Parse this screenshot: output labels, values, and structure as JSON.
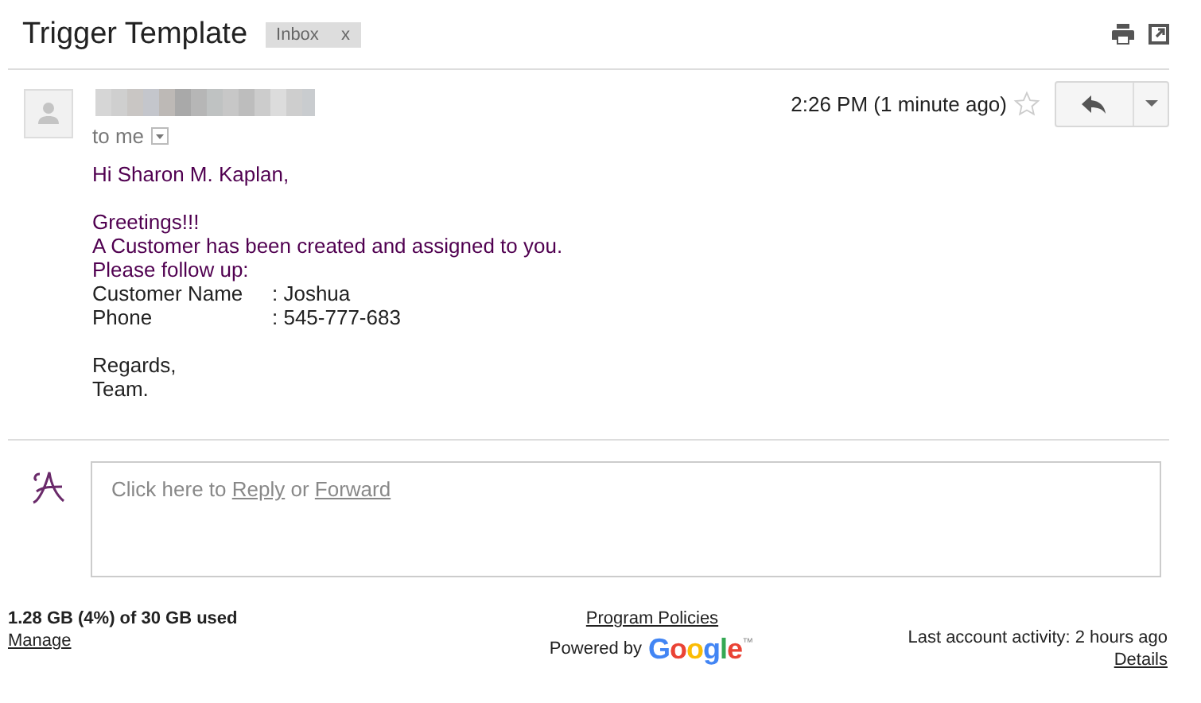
{
  "header": {
    "subject": "Trigger Template",
    "label": {
      "text": "Inbox",
      "close": "x"
    }
  },
  "message": {
    "recipient": "to me",
    "time": "2:26 PM (1 minute ago)",
    "starred": false,
    "body": [
      {
        "kind": "highlight",
        "text": "Hi Sharon M. Kaplan,"
      },
      {
        "kind": "gap"
      },
      {
        "kind": "highlight",
        "text": "Greetings!!!"
      },
      {
        "kind": "highlight",
        "text": "A Customer has been created and assigned to you."
      },
      {
        "kind": "highlight",
        "text": "Please follow up:"
      },
      {
        "kind": "field",
        "label": "Customer Name",
        "value": ": Joshua"
      },
      {
        "kind": "field",
        "label": "Phone",
        "value": ": 545-777-683"
      },
      {
        "kind": "gap"
      },
      {
        "kind": "plain",
        "text": "Regards,"
      },
      {
        "kind": "plain",
        "text": "Team."
      }
    ]
  },
  "reply_box": {
    "before": "Click here to",
    "reply": "Reply",
    "middle": "or",
    "forward": "Forward"
  },
  "footer": {
    "storage": "1.28 GB (4%) of 30 GB used",
    "manage": "Manage",
    "policies": "Program Policies",
    "powered_by": "Powered by",
    "logo": "Google",
    "trademark": "™",
    "activity": "Last account activity: 2 hours ago",
    "details": "Details"
  }
}
